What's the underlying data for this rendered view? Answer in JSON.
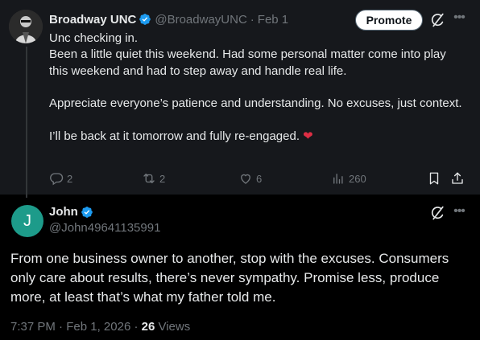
{
  "parent_tweet": {
    "author_name": "Broadway UNC",
    "handle": "@BroadwayUNC",
    "separator": "·",
    "date": "Feb 1",
    "promote_label": "Promote",
    "body_lines": [
      "Unc checking in.",
      "Been a little quiet this weekend. Had some personal matter come into play this weekend and had to step away and handle real life.",
      "",
      "Appreciate everyone’s patience and understanding. No excuses, just context.",
      "",
      "I’ll be back at it tomorrow and fully re-engaged."
    ],
    "emoji": "❤",
    "replies": "2",
    "reposts": "2",
    "likes": "6",
    "views": "260"
  },
  "reply_tweet": {
    "avatar_letter": "J",
    "author_name": "John",
    "handle": "@John49641135991",
    "body": "From one business owner to another, stop with the excuses. Consumers only care about results, there’s never sympathy. Promise less, produce more, at least that’s what my father told me.",
    "time": "7:37 PM",
    "date": "Feb 1, 2026",
    "views_count": "26",
    "views_label": "Views"
  },
  "colors": {
    "background": "#000000",
    "parent_background": "#16181c",
    "text": "#e7e9ea",
    "muted": "#71767b",
    "verified": "#1d9bf0",
    "avatar_j": "#1d9b8a",
    "heart": "#dd2e44"
  },
  "icons": {
    "reply": "reply-icon",
    "repost": "repost-icon",
    "like": "like-icon",
    "views": "views-icon",
    "bookmark": "bookmark-icon",
    "share": "share-icon",
    "grok": "grok-icon",
    "more": "more-icon",
    "verified": "verified-badge-icon"
  }
}
